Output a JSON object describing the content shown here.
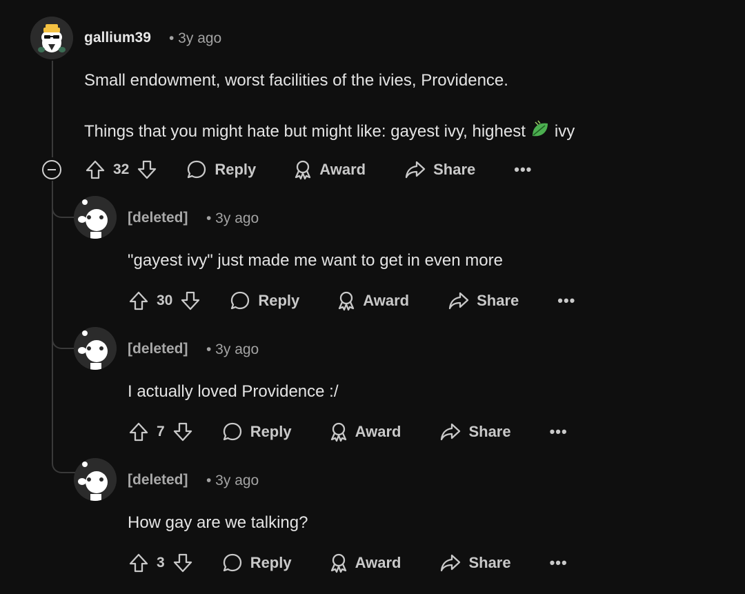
{
  "top_comment": {
    "username": "gallium39",
    "time": "• 3y ago",
    "line1": "Small endowment, worst facilities of the ivies, Providence.",
    "line2_before": "Things that you might hate but might like: gayest ivy, highest",
    "line2_after": "ivy",
    "leaf_icon": "leaf-emoji",
    "votes": "32",
    "reply": "Reply",
    "award": "Award",
    "share": "Share",
    "more": "•••"
  },
  "replies": [
    {
      "username": "[deleted]",
      "time": "• 3y ago",
      "text": "\"gayest ivy\" just made me want to get in even more",
      "votes": "30",
      "reply": "Reply",
      "award": "Award",
      "share": "Share",
      "more": "•••"
    },
    {
      "username": "[deleted]",
      "time": "• 3y ago",
      "text": "I actually loved Providence :/",
      "votes": "7",
      "reply": "Reply",
      "award": "Award",
      "share": "Share",
      "more": "•••"
    },
    {
      "username": "[deleted]",
      "time": "• 3y ago",
      "text": "How gay are we talking?",
      "votes": "3",
      "reply": "Reply",
      "award": "Award",
      "share": "Share",
      "more": "•••"
    }
  ],
  "colors": {
    "background": "#0f0f0f",
    "text": "#e4e4e4",
    "muted": "#a3a3a3",
    "leaf_green": "#4caf50"
  }
}
